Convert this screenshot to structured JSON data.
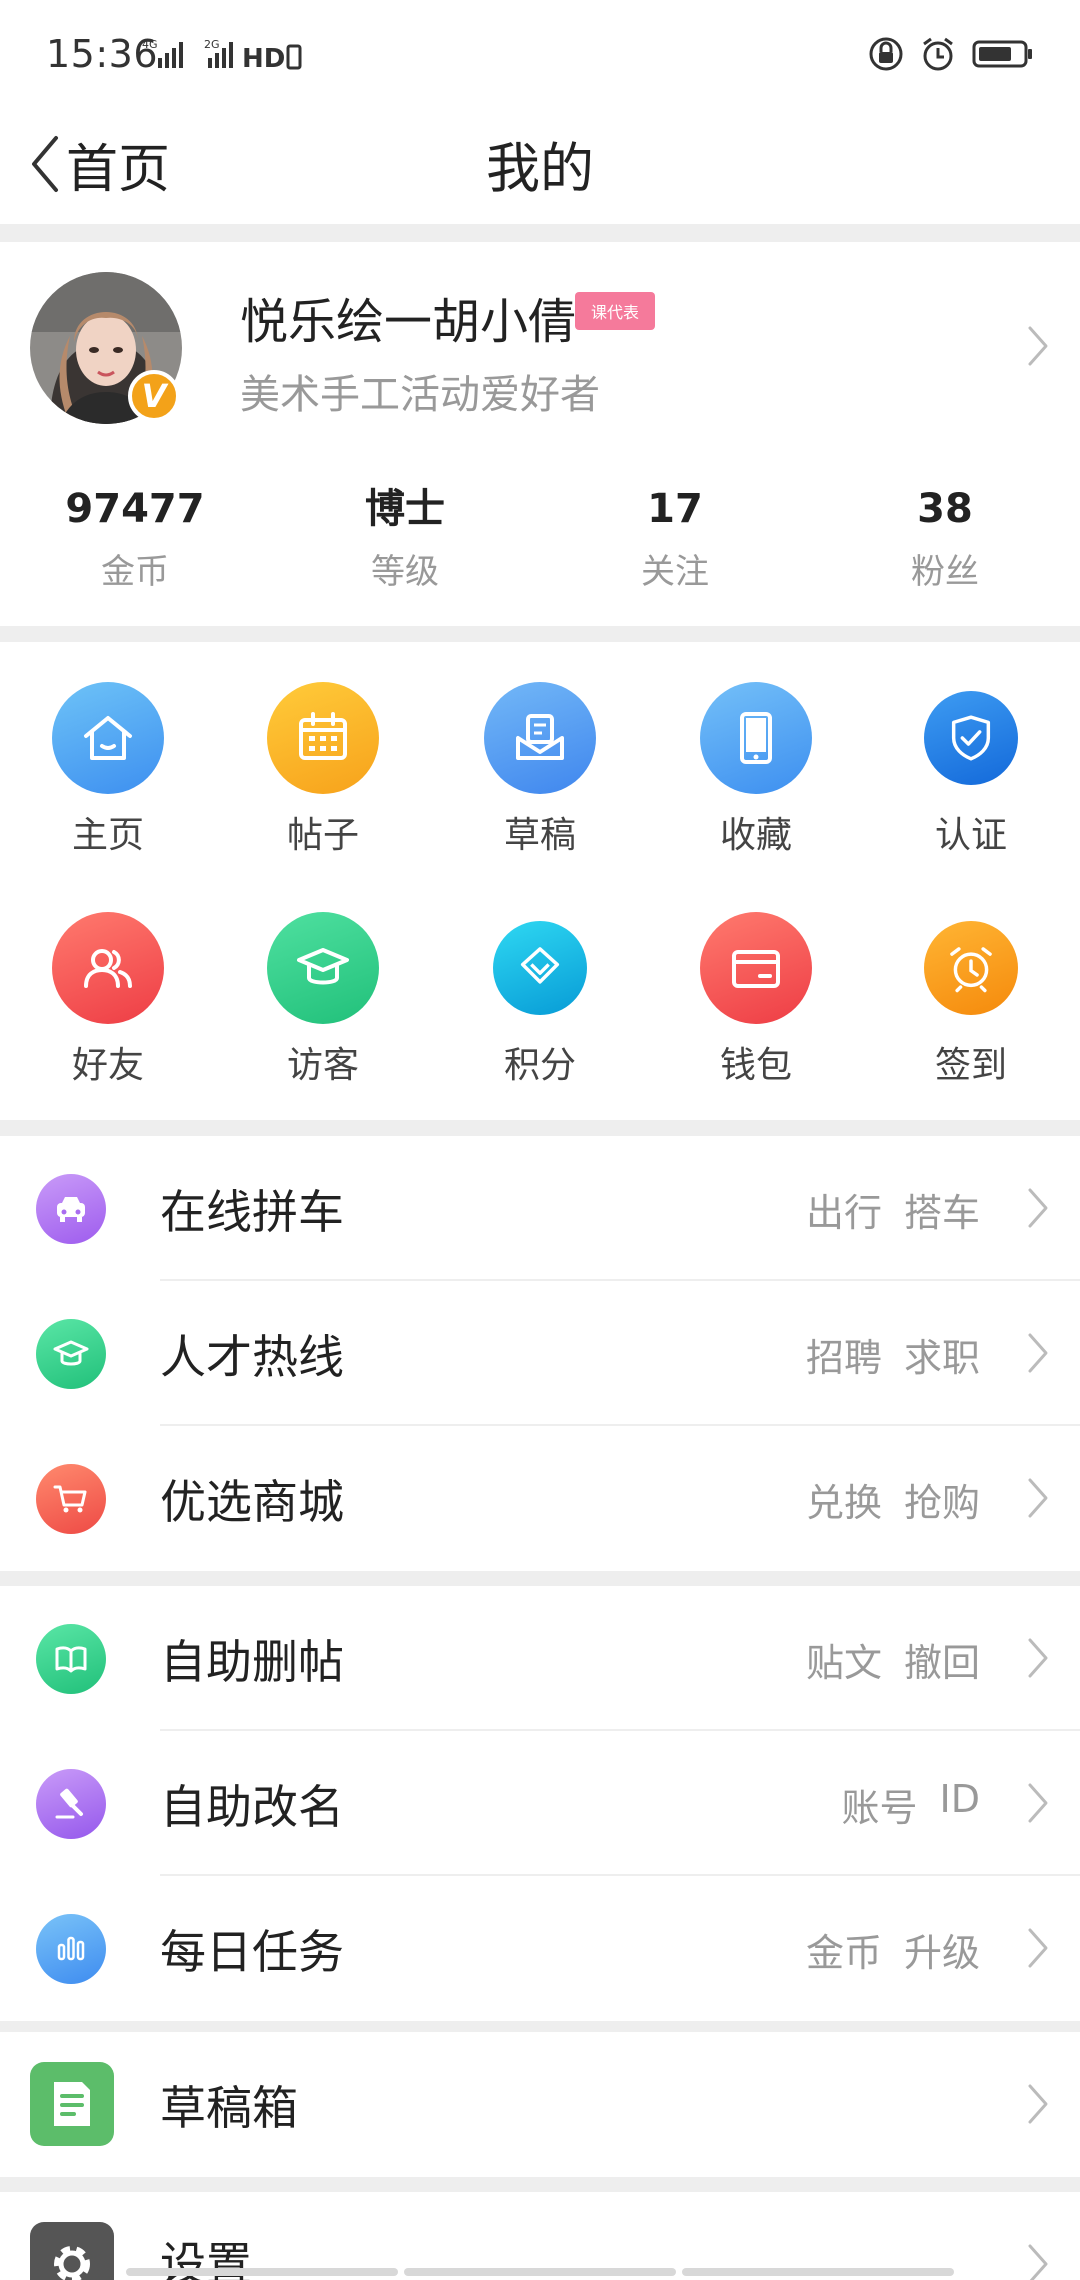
{
  "status_bar": {
    "time": "15:36",
    "network_a": "4G",
    "network_b": "2G",
    "hd_label": "HD"
  },
  "nav": {
    "back_label": "首页",
    "title": "我的"
  },
  "profile": {
    "name": "悦乐绘一胡小倩",
    "badge": "课代表",
    "bio": "美术手工活动爱好者",
    "verified_mark": "V"
  },
  "stats": [
    {
      "value": "97477",
      "label": "金币"
    },
    {
      "value": "博士",
      "label": "等级"
    },
    {
      "value": "17",
      "label": "关注"
    },
    {
      "value": "38",
      "label": "粉丝"
    }
  ],
  "grid": [
    {
      "label": "主页",
      "icon": "home-icon",
      "color": "#4aa3f3"
    },
    {
      "label": "帖子",
      "icon": "calendar-icon",
      "color": "#f8b51b"
    },
    {
      "label": "草稿",
      "icon": "inbox-icon",
      "color": "#4a90ee"
    },
    {
      "label": "收藏",
      "icon": "tablet-icon",
      "color": "#4a98f2"
    },
    {
      "label": "认证",
      "icon": "shield-icon",
      "color": "#1f7be6"
    },
    {
      "label": "好友",
      "icon": "friends-icon",
      "color": "#f3524f"
    },
    {
      "label": "访客",
      "icon": "graduation-cap-icon",
      "color": "#2ec987"
    },
    {
      "label": "积分",
      "icon": "diamond-icon",
      "color": "#11bfe8"
    },
    {
      "label": "钱包",
      "icon": "wallet-icon",
      "color": "#f5504d"
    },
    {
      "label": "签到",
      "icon": "alarm-clock-icon",
      "color": "#f89c16"
    }
  ],
  "menu_group_1": [
    {
      "label": "在线拼车",
      "tags": [
        "出行",
        "搭车"
      ],
      "icon": "taxi-icon",
      "color": "#b06cf2"
    },
    {
      "label": "人才热线",
      "tags": [
        "招聘",
        "求职"
      ],
      "icon": "graduation-cap-icon",
      "color": "#2cd08b"
    },
    {
      "label": "优选商城",
      "tags": [
        "兑换",
        "抢购"
      ],
      "icon": "cart-icon",
      "color": "#f55a48"
    }
  ],
  "menu_group_2": [
    {
      "label": "自助删帖",
      "tags": [
        "贴文",
        "撤回"
      ],
      "icon": "book-icon",
      "color": "#2cd08b"
    },
    {
      "label": "自助改名",
      "tags": [
        "账号",
        "ID"
      ],
      "icon": "gavel-icon",
      "color": "#a56cf0"
    },
    {
      "label": "每日任务",
      "tags": [
        "金币",
        "升级"
      ],
      "icon": "bar-chart-icon",
      "color": "#4da0f2"
    }
  ],
  "menu_drafts": {
    "label": "草稿箱",
    "icon": "document-icon",
    "color": "#5cbd6a"
  },
  "menu_settings": {
    "label": "设置",
    "icon": "gear-icon",
    "color": "#555555"
  }
}
